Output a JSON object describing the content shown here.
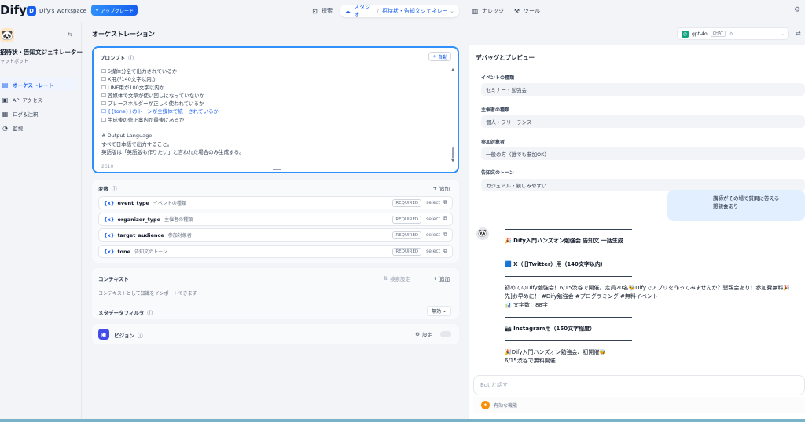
{
  "topbar": {
    "logo": "Dify",
    "workspace_initial": "D",
    "workspace_name": "Dify's Workspace",
    "upgrade_label": "アップグレード",
    "nav": {
      "explore": "探索",
      "studio": "スタジオ",
      "current_app": "招待状・告知文ジェネレー...",
      "knowledge": "ナレッジ",
      "tools": "ツール"
    }
  },
  "sidebar": {
    "app_name": "招待状・告知文ジェネレーター",
    "app_type": "ャットボット",
    "items": [
      {
        "label": "オーケストレート",
        "icon": "▤",
        "active": true
      },
      {
        "label": "API アクセス",
        "icon": "▣",
        "active": false
      },
      {
        "label": "ログ＆注釈",
        "icon": "▦",
        "active": false
      },
      {
        "label": "監視",
        "icon": "◔",
        "active": false
      }
    ]
  },
  "orchestration": {
    "title": "オーケストレーション",
    "prompt": {
      "label": "プロンプト",
      "auto_label": "自動",
      "lines": [
        "☐ 5媒体分全て出力されているか",
        "☐ X用が140文字以内か",
        "☐ LINE用が100文字以内か",
        "☐ 各媒体で文章が使い回しになっていないか",
        "☐ プレースホルダーが正しく使われているか",
        "☐ {{tone}}のトーンが全媒体で統一されているか",
        "☐ 生成後の修正案内が最後にあるか",
        "",
        "# Output Language",
        "すべて日本語で出力すること。",
        "英語版は「英語版も作りたい」と言われた場合のみ生成する。"
      ],
      "char_count": "2610"
    },
    "variables": {
      "title": "変数",
      "add_label": "追加",
      "items": [
        {
          "key": "event_type",
          "label": "イベントの種類",
          "required": "REQUIRED",
          "type": "select"
        },
        {
          "key": "organizer_type",
          "label": "主催者の種類",
          "required": "REQUIRED",
          "type": "select"
        },
        {
          "key": "target_audience",
          "label": "参加対象者",
          "required": "REQUIRED",
          "type": "select"
        },
        {
          "key": "tone",
          "label": "告知文のトーン",
          "required": "REQUIRED",
          "type": "select"
        }
      ]
    },
    "context": {
      "title": "コンテキスト",
      "search_settings": "検索設定",
      "add_label": "追加",
      "hint": "コンテキストとして知識をインポートできます",
      "metadata_filter": "メタデータフィルタ",
      "metadata_value": "無効"
    },
    "vision": {
      "title": "ビジョン",
      "settings_label": "設定"
    }
  },
  "debug": {
    "model_name": "gpt-4o",
    "model_mode": "CHAT",
    "title": "デバッグとプレビュー",
    "inputs": [
      {
        "label": "イベントの種類",
        "value": "セミナー・勉強会"
      },
      {
        "label": "主催者の種類",
        "value": "個人・フリーランス"
      },
      {
        "label": "参加対象者",
        "value": "一般の方（誰でも参加OK）"
      },
      {
        "label": "告知文のトーン",
        "value": "カジュアル・親しみやすい"
      }
    ],
    "user_message_lines": [
      "講師がその場で質問に答える",
      "懇親会あり"
    ],
    "answer": {
      "title": "🎉 Dify入門ハンズオン勉強会 告知文 一括生成",
      "x_heading": "🟦 X（旧Twitter）用（140文字以内）",
      "x_text_1": "初めてのDify勉強会！6/15渋谷で開催。定員20名🐝Difyでアプリを作ってみませんか？懇親会あり！参加費無料🎉",
      "x_text_2": "先]お早めに！ #Dify勉強会 #プログラミング #無料イベント",
      "x_count": "📊 文字数：88字",
      "ig_heading": "📷 Instagram用（150文字程度）",
      "ig_text_1": "🎉Dify入門ハンズオン勉強会、初開催🐝",
      "ig_text_2": "6/15渋谷で無料開催！"
    },
    "chat_placeholder": "Bot と話す",
    "feature_label": "有効な機能"
  }
}
